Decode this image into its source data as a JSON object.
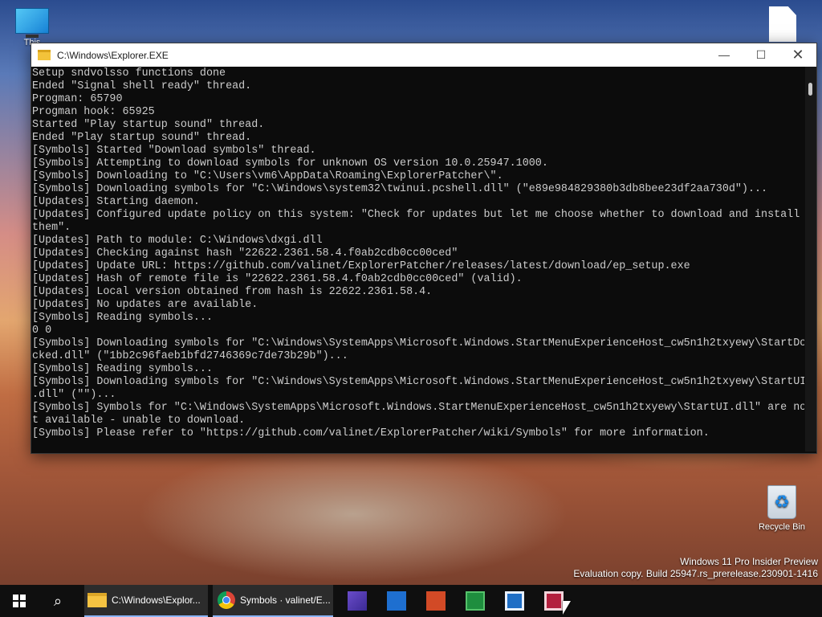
{
  "desktop": {
    "this_pc_label": "This",
    "recycle_bin_label": "Recycle Bin",
    "watermark_line1": "Windows 11 Pro Insider Preview",
    "watermark_line2": "Evaluation copy. Build 25947.rs_prerelease.230901-1416"
  },
  "window": {
    "title": "C:\\Windows\\Explorer.EXE",
    "minimize_glyph": "—",
    "maximize_glyph": "☐",
    "close_glyph": "✕",
    "lines": [
      "Setup sndvolsso functions done",
      "Ended \"Signal shell ready\" thread.",
      "Progman: 65790",
      "Progman hook: 65925",
      "Started \"Play startup sound\" thread.",
      "Ended \"Play startup sound\" thread.",
      "[Symbols] Started \"Download symbols\" thread.",
      "[Symbols] Attempting to download symbols for unknown OS version 10.0.25947.1000.",
      "[Symbols] Downloading to \"C:\\Users\\vm6\\AppData\\Roaming\\ExplorerPatcher\\\".",
      "[Symbols] Downloading symbols for \"C:\\Windows\\system32\\twinui.pcshell.dll\" (\"e89e984829380b3db8bee23df2aa730d\")...",
      "[Updates] Starting daemon.",
      "[Updates] Configured update policy on this system: \"Check for updates but let me choose whether to download and install",
      "them\".",
      "[Updates] Path to module: C:\\Windows\\dxgi.dll",
      "[Updates] Checking against hash \"22622.2361.58.4.f0ab2cdb0cc00ced\"",
      "[Updates] Update URL: https://github.com/valinet/ExplorerPatcher/releases/latest/download/ep_setup.exe",
      "[Updates] Hash of remote file is \"22622.2361.58.4.f0ab2cdb0cc00ced\" (valid).",
      "[Updates] Local version obtained from hash is 22622.2361.58.4.",
      "[Updates] No updates are available.",
      "[Symbols] Reading symbols...",
      "0 0",
      "[Symbols] Downloading symbols for \"C:\\Windows\\SystemApps\\Microsoft.Windows.StartMenuExperienceHost_cw5n1h2txyewy\\StartDo",
      "cked.dll\" (\"1bb2c96faeb1bfd2746369c7de73b29b\")...",
      "[Symbols] Reading symbols...",
      "[Symbols] Downloading symbols for \"C:\\Windows\\SystemApps\\Microsoft.Windows.StartMenuExperienceHost_cw5n1h2txyewy\\StartUI",
      ".dll\" (\"\")...",
      "[Symbols] Symbols for \"C:\\Windows\\SystemApps\\Microsoft.Windows.StartMenuExperienceHost_cw5n1h2txyewy\\StartUI.dll\" are no",
      "t available - unable to download.",
      "[Symbols] Please refer to \"https://github.com/valinet/ExplorerPatcher/wiki/Symbols\" for more information."
    ]
  },
  "taskbar": {
    "search_glyph": "⌕",
    "task1_label": "C:\\Windows\\Explor...",
    "task2_label": "Symbols · valinet/E...",
    "recycle_glyph": "♻"
  }
}
